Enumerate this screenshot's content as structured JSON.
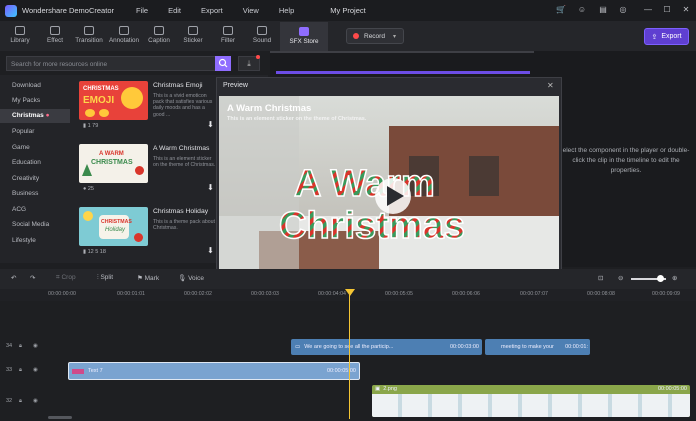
{
  "app": {
    "name": "Wondershare DemoCreator",
    "menu": [
      "File",
      "Edit",
      "Export",
      "View",
      "Help"
    ],
    "project_title": "My Project"
  },
  "toolbar": {
    "tabs": [
      "Library",
      "Effect",
      "Transition",
      "Annotation",
      "Caption",
      "Sticker",
      "Filter",
      "Sound"
    ],
    "active_tab": "SFX Store",
    "record_label": "Record",
    "export_label": "Export"
  },
  "search": {
    "placeholder": "Search for more resources online",
    "value": ""
  },
  "categories": [
    "Download",
    "My Packs",
    "Christmas",
    "Popular",
    "Game",
    "Education",
    "Creativity",
    "Business",
    "ACG",
    "Social Media",
    "Lifestyle"
  ],
  "active_category": "Christmas",
  "cards": [
    {
      "title": "Christmas Emoji",
      "desc": "This is a vivid emoticon pack that satisfies various daily moods and has a good ...",
      "meta": "1    79"
    },
    {
      "title": "A Warm Christmas",
      "desc": "This is an element sticker on the theme of Christmas.",
      "meta": "25"
    },
    {
      "title": "Christmas Holiday",
      "desc": "This is a theme pack about Christmas.",
      "meta": "12    5    18"
    }
  ],
  "thumb_texts": [
    "CHRISTMAS",
    "EMOJI",
    "A WARM",
    "CHRISTMAS",
    "CHRISTMAS",
    "Holiday"
  ],
  "preview": {
    "label": "Preview",
    "heading": "A Warm Christmas",
    "sub": "This is an element sticker on the theme of Christmas.",
    "art_line1": "A Warm",
    "art_line2": "Christmas"
  },
  "properties_hint": "elect the component in the player or double-click the clip in the timeline to edit the properties.",
  "timeline_tools": [
    "Crop",
    "Split",
    "Mark",
    "Voice"
  ],
  "ruler_ticks": [
    "00:00:00:00",
    "00:00:01:01",
    "00:00:02:02",
    "00:00:03:03",
    "00:00:04:04",
    "00:00:05:05",
    "00:00:06:06",
    "00:00:07:07",
    "00:00:08:08",
    "00:00:09:09"
  ],
  "tracks": [
    {
      "num": "34"
    },
    {
      "num": "33"
    },
    {
      "num": "32"
    }
  ],
  "clips": {
    "caption1": {
      "label": "We are going to see all the particip...",
      "time": "00:00:03:00"
    },
    "caption2": {
      "label": "meeting to make your",
      "time": "00:00:01:"
    },
    "text": {
      "label": "Text 7",
      "time": "00:00:05:00"
    },
    "image": {
      "label": "2.png",
      "time": "00:00:05:00"
    }
  }
}
